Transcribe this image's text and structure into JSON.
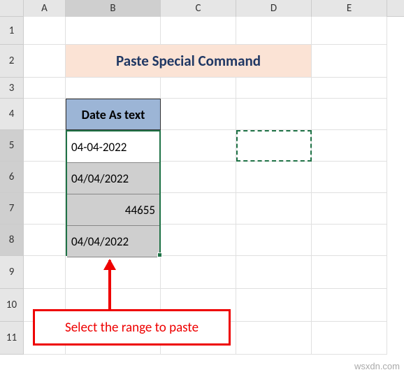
{
  "columns": [
    "A",
    "B",
    "C",
    "D",
    "E"
  ],
  "rows": [
    "1",
    "2",
    "3",
    "4",
    "5",
    "6",
    "7",
    "8",
    "9",
    "10",
    "11"
  ],
  "title": "Paste Special Command",
  "table_header": "Date As text",
  "selection": {
    "range": "B5:B8",
    "cells": [
      {
        "value": "04-04-2022",
        "align": "left"
      },
      {
        "value": "04/04/2022",
        "align": "left"
      },
      {
        "value": "44655",
        "align": "right"
      },
      {
        "value": "04/04/2022",
        "align": "left"
      }
    ]
  },
  "paste_destination": "D5",
  "callout_text": "Select the range to paste",
  "watermark": "wsxdn.com",
  "chart_data": {
    "type": "table",
    "title": "Date As text",
    "columns": [
      "Date As text"
    ],
    "rows": [
      [
        "04-04-2022"
      ],
      [
        "04/04/2022"
      ],
      [
        "44655"
      ],
      [
        "04/04/2022"
      ]
    ]
  }
}
